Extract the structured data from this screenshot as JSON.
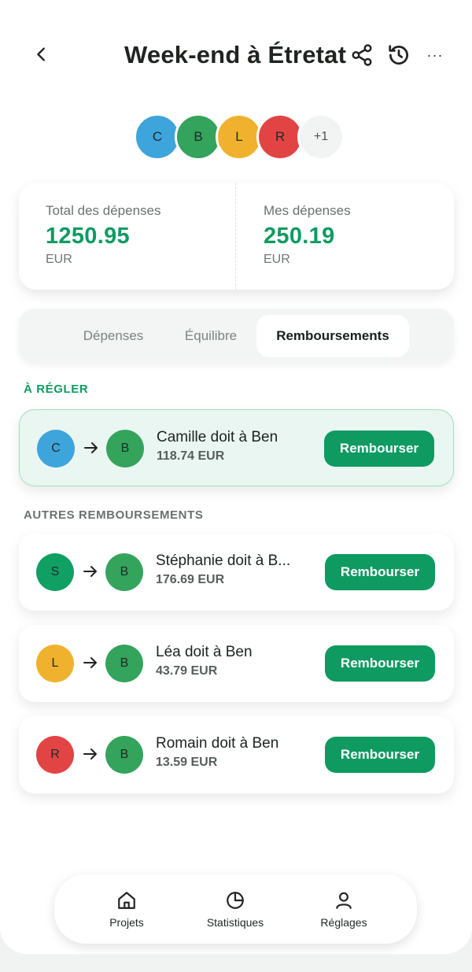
{
  "header": {
    "title": "Week-end à Étretat",
    "icons": {
      "back": "chevron-left-icon",
      "share": "share-icon",
      "history": "history-icon",
      "more": "more-horizontal-icon"
    },
    "more_label": "···"
  },
  "members": {
    "avatars": [
      {
        "initial": "C",
        "color": "#3ea4dc"
      },
      {
        "initial": "B",
        "color": "#34a35c"
      },
      {
        "initial": "L",
        "color": "#f0b22e"
      },
      {
        "initial": "R",
        "color": "#e24444"
      }
    ],
    "overflow": "+1"
  },
  "summary": {
    "total_label": "Total des dépenses",
    "total_value": "1250.95",
    "total_currency": "EUR",
    "mine_label": "Mes dépenses",
    "mine_value": "250.19",
    "mine_currency": "EUR"
  },
  "tabs": [
    {
      "label": "Dépenses",
      "active": false
    },
    {
      "label": "Équilibre",
      "active": false
    },
    {
      "label": "Remboursements",
      "active": true
    }
  ],
  "to_settle": {
    "section_label": "À RÉGLER",
    "item": {
      "from": "C",
      "from_color": "#3ea4dc",
      "to": "B",
      "to_color": "#34a35c",
      "text": "Camille doit à Ben",
      "amount": "118.74 EUR",
      "button": "Rembourser"
    }
  },
  "others": {
    "section_label": "AUTRES REMBOURSEMENTS",
    "items": [
      {
        "from": "S",
        "from_color": "#10a064",
        "to": "B",
        "to_color": "#34a35c",
        "text": "Stéphanie doit à B...",
        "amount": "176.69 EUR",
        "button": "Rembourser"
      },
      {
        "from": "L",
        "from_color": "#f0b22e",
        "to": "B",
        "to_color": "#34a35c",
        "text": "Léa doit à Ben",
        "amount": "43.79 EUR",
        "button": "Rembourser"
      },
      {
        "from": "R",
        "from_color": "#e24444",
        "to": "B",
        "to_color": "#34a35c",
        "text": "Romain doit à Ben",
        "amount": "13.59 EUR",
        "button": "Rembourser"
      }
    ]
  },
  "bottom_nav": [
    {
      "label": "Projets",
      "icon": "home-icon"
    },
    {
      "label": "Statistiques",
      "icon": "pie-chart-icon"
    },
    {
      "label": "Réglages",
      "icon": "user-icon"
    }
  ],
  "colors": {
    "accent": "#0f9a62",
    "highlight_bg": "#eaf6f1"
  }
}
